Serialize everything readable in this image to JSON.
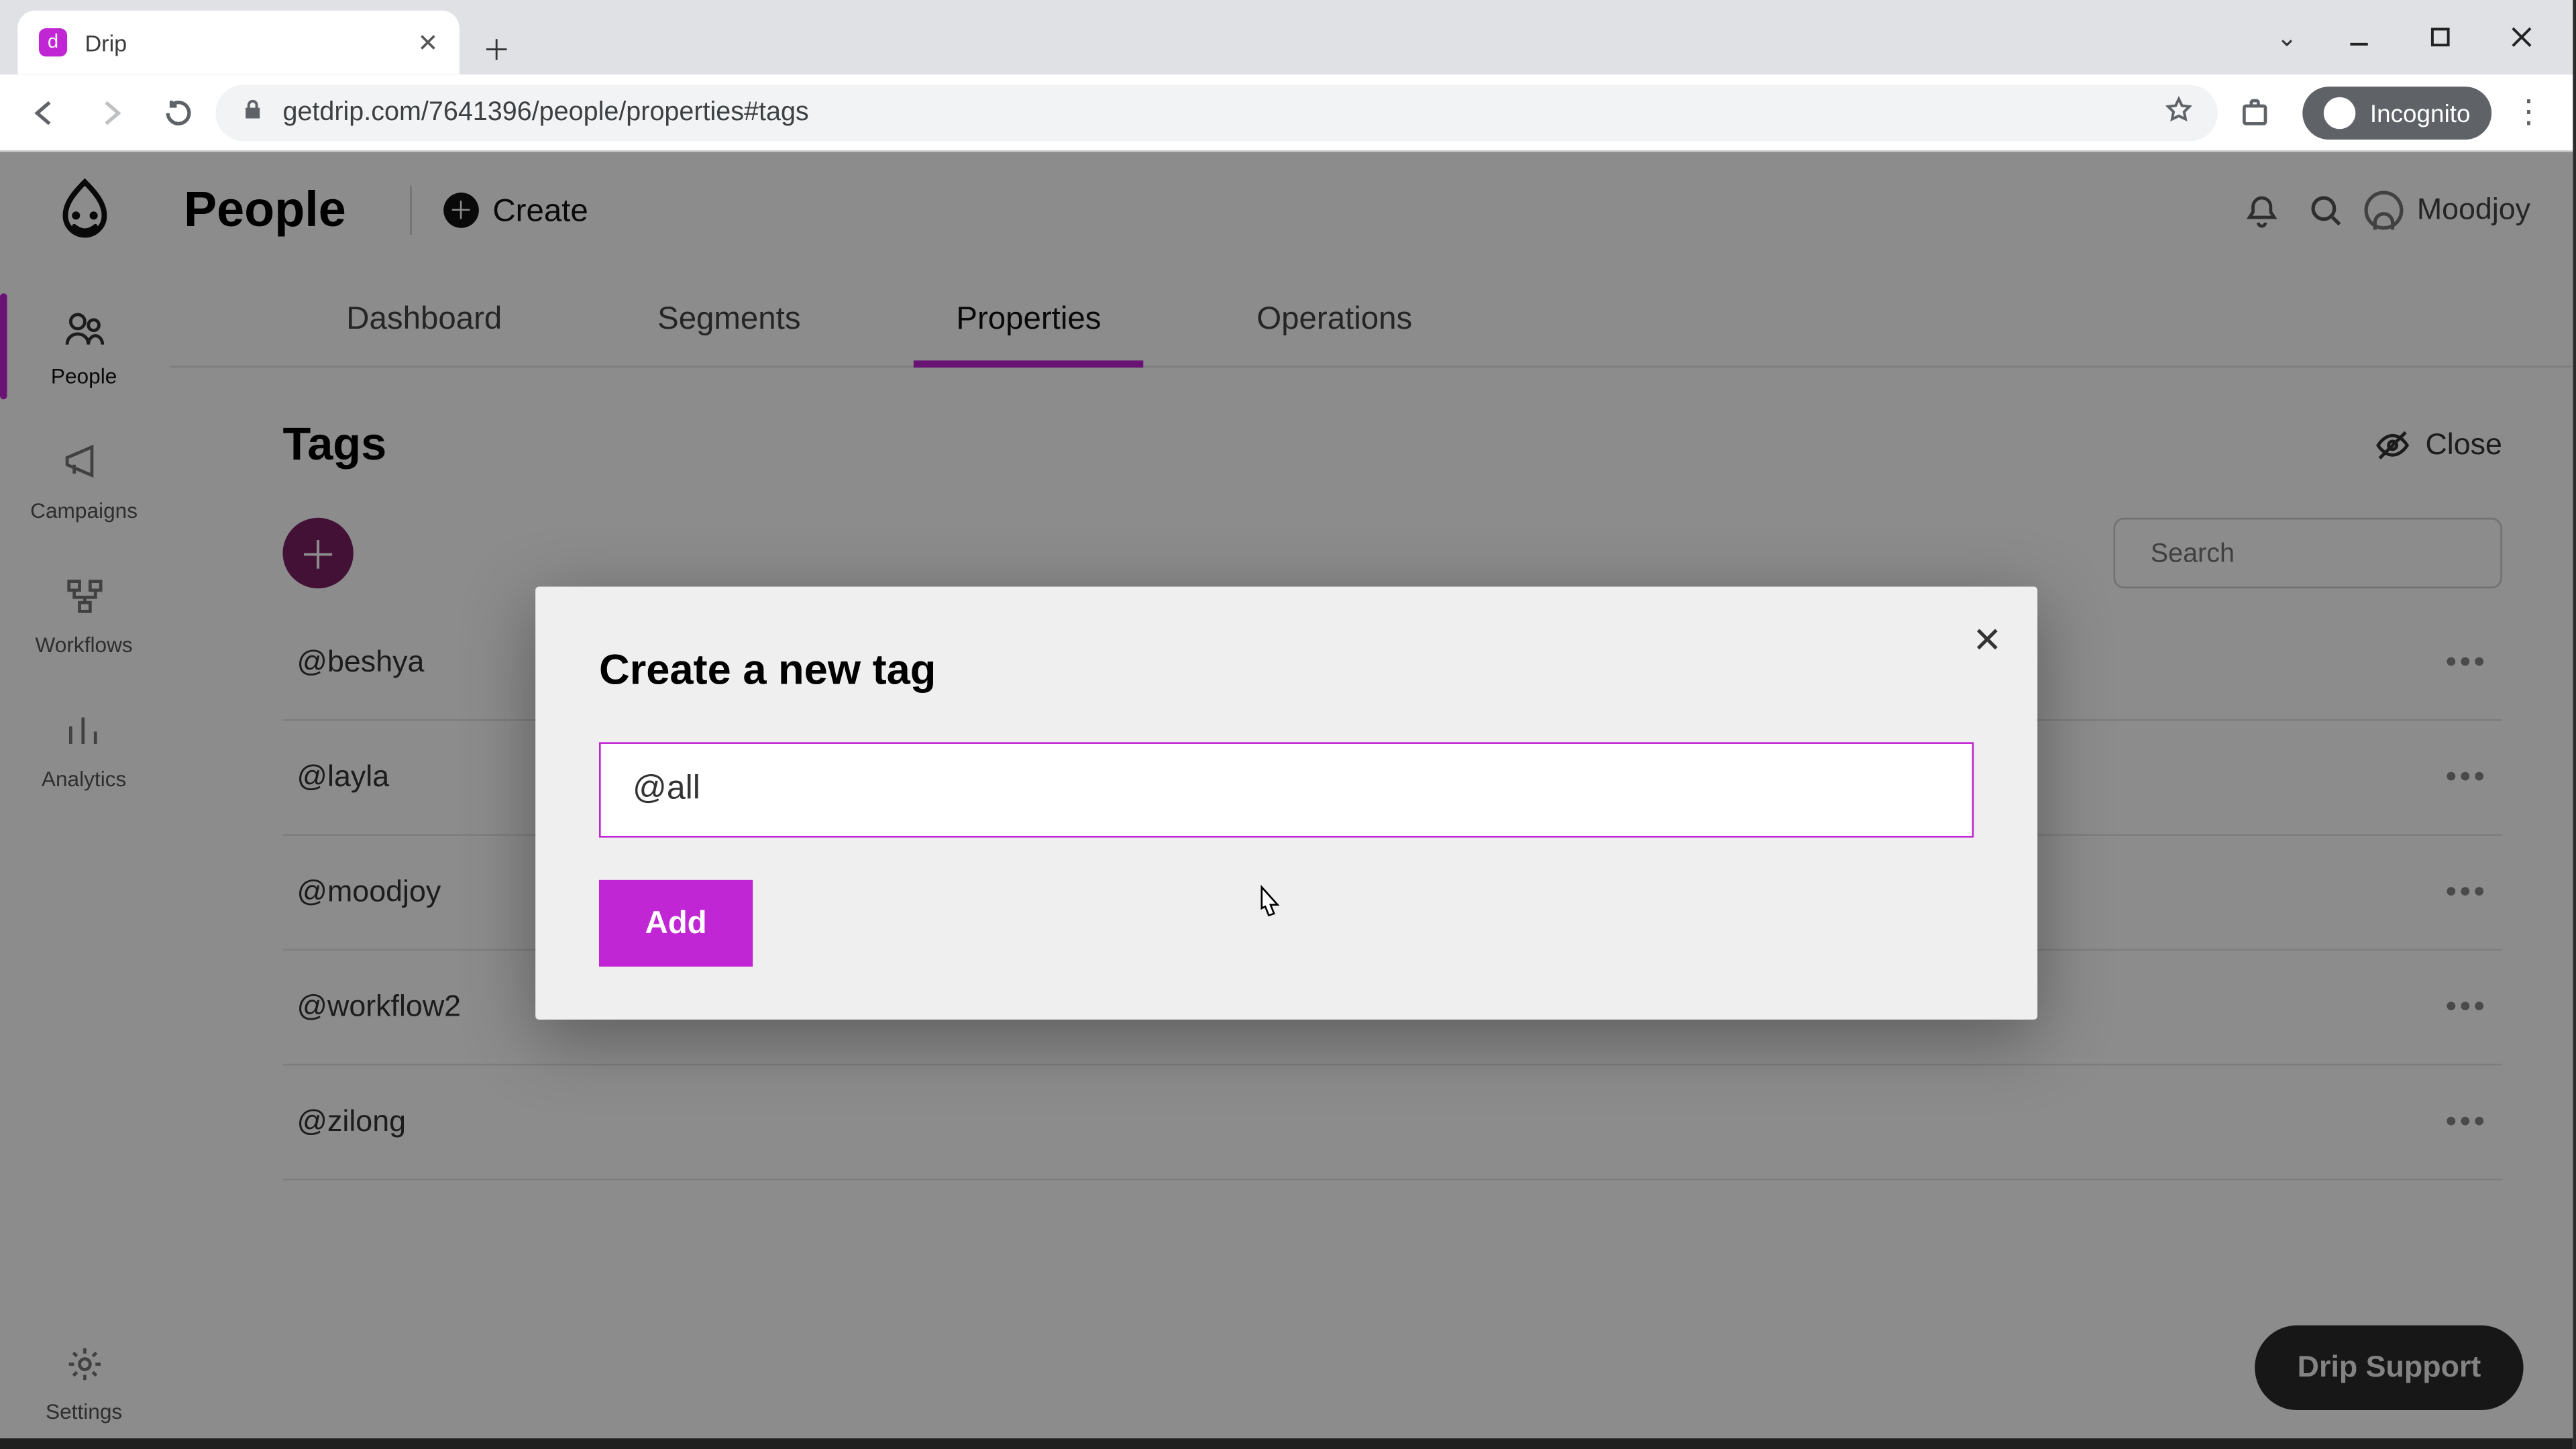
{
  "browser": {
    "tab_title": "Drip",
    "url": "getdrip.com/7641396/people/properties#tags",
    "incognito_label": "Incognito"
  },
  "header": {
    "title": "People",
    "create_label": "Create",
    "user_name": "Moodjoy"
  },
  "leftnav": {
    "items": [
      {
        "label": "People",
        "active": true
      },
      {
        "label": "Campaigns",
        "active": false
      },
      {
        "label": "Workflows",
        "active": false
      },
      {
        "label": "Analytics",
        "active": false
      }
    ],
    "settings_label": "Settings"
  },
  "subtabs": {
    "items": [
      "Dashboard",
      "Segments",
      "Properties",
      "Operations"
    ],
    "active_index": 2
  },
  "tags_section": {
    "heading": "Tags",
    "close_label": "Close",
    "search_placeholder": "Search",
    "tags": [
      "@beshya",
      "@layla",
      "@moodjoy",
      "@workflow2",
      "@zilong"
    ]
  },
  "modal": {
    "title": "Create a new tag",
    "input_value": "@all",
    "add_label": "Add"
  },
  "support": {
    "label": "Drip Support"
  }
}
